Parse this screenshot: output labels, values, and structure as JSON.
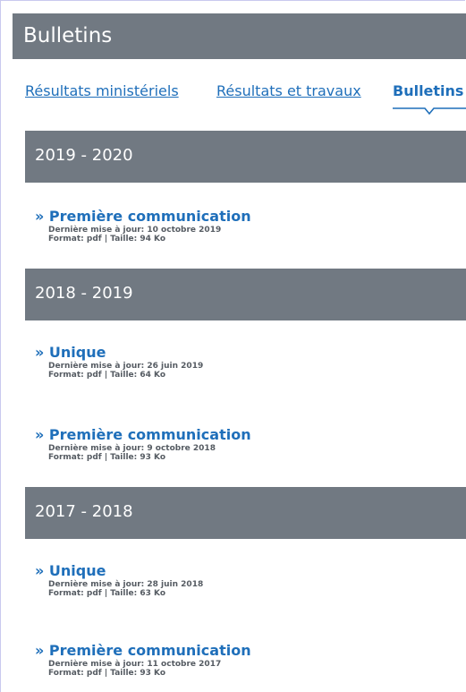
{
  "header": {
    "title": "Bulletins"
  },
  "tabs": [
    {
      "label": "Résultats ministériels"
    },
    {
      "label": "Résultats et travaux"
    },
    {
      "label": "Bulletins"
    }
  ],
  "sections": [
    {
      "label": "2019 - 2020",
      "docs": [
        {
          "title": "» Première communication",
          "updated": "Dernière mise à jour: 10 octobre 2019",
          "format": "Format: pdf | Taille: 94 Ko"
        }
      ]
    },
    {
      "label": "2018 - 2019",
      "docs": [
        {
          "title": "» Unique",
          "updated": "Dernière mise à jour: 26 juin 2019",
          "format": "Format: pdf | Taille: 64 Ko"
        },
        {
          "title": "» Première communication",
          "updated": "Dernière mise à jour: 9 octobre 2018",
          "format": "Format: pdf | Taille: 93 Ko"
        }
      ]
    },
    {
      "label": "2017 - 2018",
      "docs": [
        {
          "title": "» Unique",
          "updated": "Dernière mise à jour: 28 juin 2018",
          "format": "Format: pdf | Taille: 63 Ko"
        },
        {
          "title": "» Première communication",
          "updated": "Dernière mise à jour: 11 octobre 2017",
          "format": "Format: pdf | Taille: 93 Ko"
        }
      ]
    }
  ],
  "colors": {
    "header_bg": "#717982",
    "link": "#1f6fba",
    "meta_text": "#555b62"
  }
}
